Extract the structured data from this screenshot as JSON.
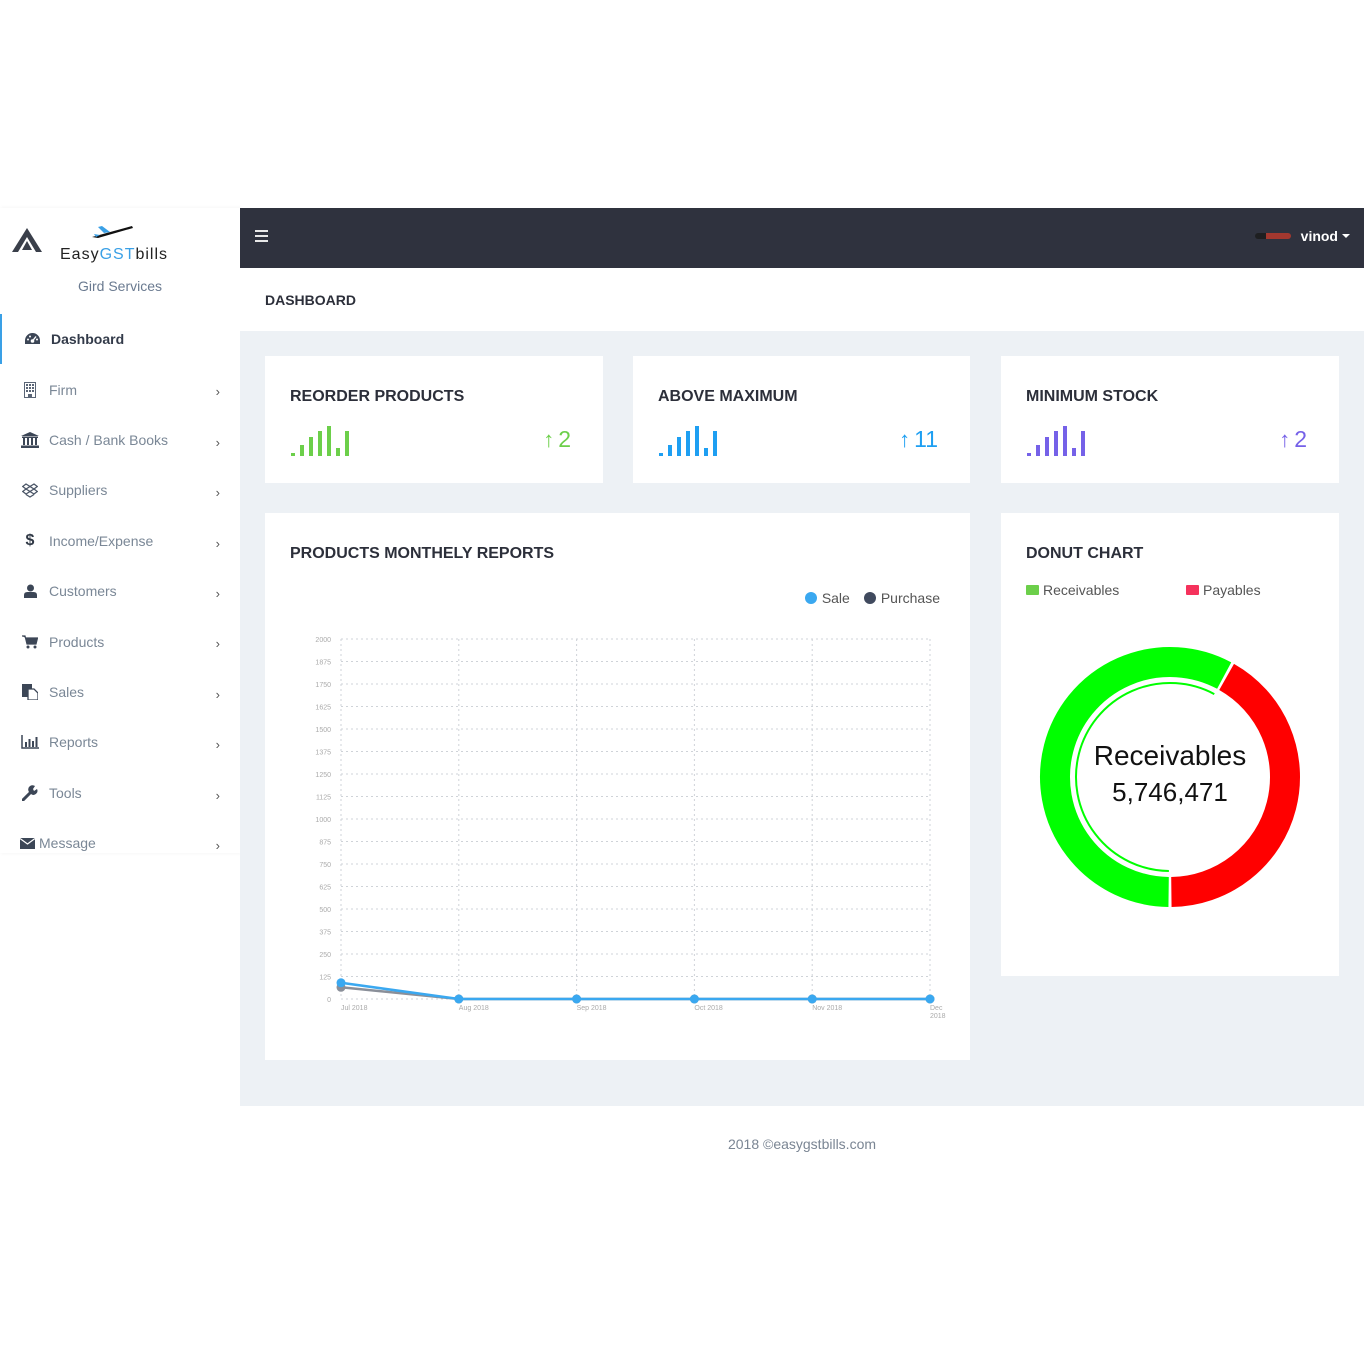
{
  "brand": {
    "name_part1": "Easy",
    "name_part2": "GST",
    "name_part3": "bills",
    "firm_name": "Gird Services"
  },
  "sidebar": {
    "items": [
      {
        "label": "Dashboard",
        "icon": "dashboard-icon",
        "active": true,
        "has_children": false
      },
      {
        "label": "Firm",
        "icon": "building-icon",
        "has_children": true
      },
      {
        "label": "Cash / Bank Books",
        "icon": "bank-icon",
        "has_children": true
      },
      {
        "label": "Suppliers",
        "icon": "dropbox-icon",
        "has_children": true
      },
      {
        "label": "Income/Expense",
        "icon": "dollar-icon",
        "has_children": true
      },
      {
        "label": "Customers",
        "icon": "user-icon",
        "has_children": true
      },
      {
        "label": "Products",
        "icon": "cart-icon",
        "has_children": true
      },
      {
        "label": "Sales",
        "icon": "files-icon",
        "has_children": true
      },
      {
        "label": "Reports",
        "icon": "bar-chart-icon",
        "has_children": true
      },
      {
        "label": "Tools",
        "icon": "wrench-icon",
        "has_children": true
      },
      {
        "label": "Message",
        "icon": "envelope-icon",
        "has_children": true
      }
    ],
    "chevron": "›"
  },
  "topbar": {
    "user_name": "vinod"
  },
  "page": {
    "title": "DASHBOARD"
  },
  "stats": [
    {
      "title": "REORDER PRODUCTS",
      "value": "2",
      "arrow": "↑",
      "color": "#6ccf4a",
      "spark": [
        1,
        4,
        7,
        9,
        11,
        3,
        9
      ]
    },
    {
      "title": "ABOVE MAXIMUM",
      "value": "11",
      "arrow": "↑",
      "color": "#1e9ff2",
      "spark": [
        1,
        4,
        7,
        9,
        11,
        3,
        9
      ]
    },
    {
      "title": "MINIMUM STOCK",
      "value": "2",
      "arrow": "↑",
      "color": "#7561e8",
      "spark": [
        1,
        4,
        7,
        9,
        11,
        3,
        9
      ]
    }
  ],
  "monthly_report": {
    "title": "PRODUCTS MONTHELY REPORTS",
    "legend": [
      {
        "label": "Sale",
        "color": "#3aa8f0"
      },
      {
        "label": "Purchase",
        "color": "#404a5e"
      }
    ]
  },
  "donut": {
    "title": "DONUT CHART",
    "legend": [
      {
        "label": "Receivables",
        "color": "#6ccf4a"
      },
      {
        "label": "Payables",
        "color": "#f5325c"
      }
    ],
    "center_label": "Receivables",
    "center_value": "5,746,471"
  },
  "footer": {
    "text": "2018 ©easygstbills.com"
  },
  "chart_data": [
    {
      "type": "line",
      "title": "PRODUCTS MONTHELY REPORTS",
      "xlabel": "",
      "ylabel": "",
      "categories": [
        "Jul 2018",
        "Aug 2018",
        "Sep 2018",
        "Oct 2018",
        "Nov 2018",
        "Dec 2018"
      ],
      "series": [
        {
          "name": "Sale",
          "values": [
            90,
            0,
            0,
            0,
            0,
            0
          ],
          "color": "#3aa8f0"
        },
        {
          "name": "Purchase",
          "values": [
            65,
            0,
            0,
            0,
            0,
            0
          ],
          "color": "#8a8f99"
        }
      ],
      "yticks": [
        0,
        125,
        250,
        375,
        500,
        625,
        750,
        875,
        1000,
        1125,
        1250,
        1375,
        1500,
        1625,
        1750,
        1875,
        2000
      ],
      "ylim": [
        0,
        2000
      ],
      "grid": true,
      "legend": "top-right"
    },
    {
      "type": "pie",
      "title": "DONUT CHART",
      "labels": [
        "Receivables",
        "Payables"
      ],
      "values": [
        58,
        42
      ],
      "colors": [
        "#00ff00",
        "#ff0000"
      ],
      "selected": "Receivables",
      "center_text": [
        "Receivables",
        "5,746,471"
      ],
      "legend": "top"
    }
  ]
}
